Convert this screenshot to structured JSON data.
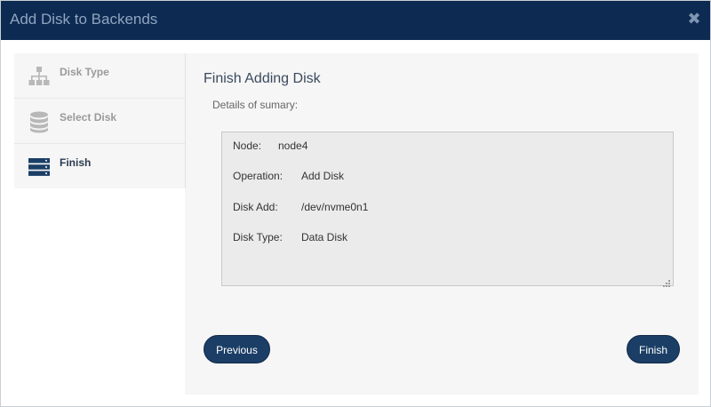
{
  "dialog": {
    "title": "Add Disk to Backends",
    "close_icon": "close-icon"
  },
  "sidebar": {
    "items": [
      {
        "label": "Disk Type",
        "icon": "sitemap-icon",
        "active": false
      },
      {
        "label": "Select Disk",
        "icon": "database-icon",
        "active": false
      },
      {
        "label": "Finish",
        "icon": "server-icon",
        "active": true
      }
    ]
  },
  "content": {
    "title": "Finish Adding Disk",
    "subtitle": "Details of sumary:",
    "summary": [
      {
        "key": "Node:",
        "value": "node4"
      },
      {
        "key": "Operation:",
        "value": "Add Disk"
      },
      {
        "key": "Disk Add:",
        "value": "/dev/nvme0n1"
      },
      {
        "key": "Disk Type:",
        "value": "Data Disk"
      }
    ]
  },
  "buttons": {
    "previous": "Previous",
    "finish": "Finish"
  },
  "colors": {
    "titlebar": "#0d2b52",
    "button": "#1b3e66",
    "active_icon": "#1b3e66",
    "inactive_icon": "#b8b8b8"
  }
}
